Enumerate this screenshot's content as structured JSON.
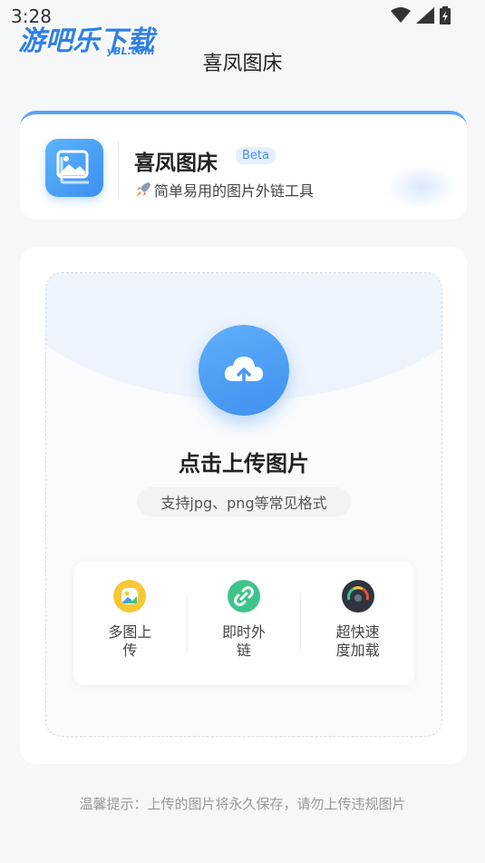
{
  "status_bar": {
    "time": "3:28"
  },
  "watermark": {
    "main": "游吧乐下载",
    "sub": "yBL.com"
  },
  "app_bar": {
    "title": "喜凤图床"
  },
  "header_card": {
    "app_name": "喜凤图床",
    "badge": "Beta",
    "tagline": "简单易用的图片外链工具"
  },
  "upload": {
    "title": "点击上传图片",
    "formats": "支持jpg、png等常见格式"
  },
  "features": [
    {
      "label": "多图上传",
      "icon": "gallery-icon",
      "color": "#f7c736"
    },
    {
      "label": "即时外链",
      "icon": "link-icon",
      "color": "#3ec48b"
    },
    {
      "label": "超快速度加载",
      "icon": "speedometer-icon",
      "color": "#2f3440"
    }
  ],
  "tip": "温馨提示：上传的图片将永久保存，请勿上传违规图片",
  "colors": {
    "accent": "#4a96f3",
    "background": "#f6f7f9"
  }
}
